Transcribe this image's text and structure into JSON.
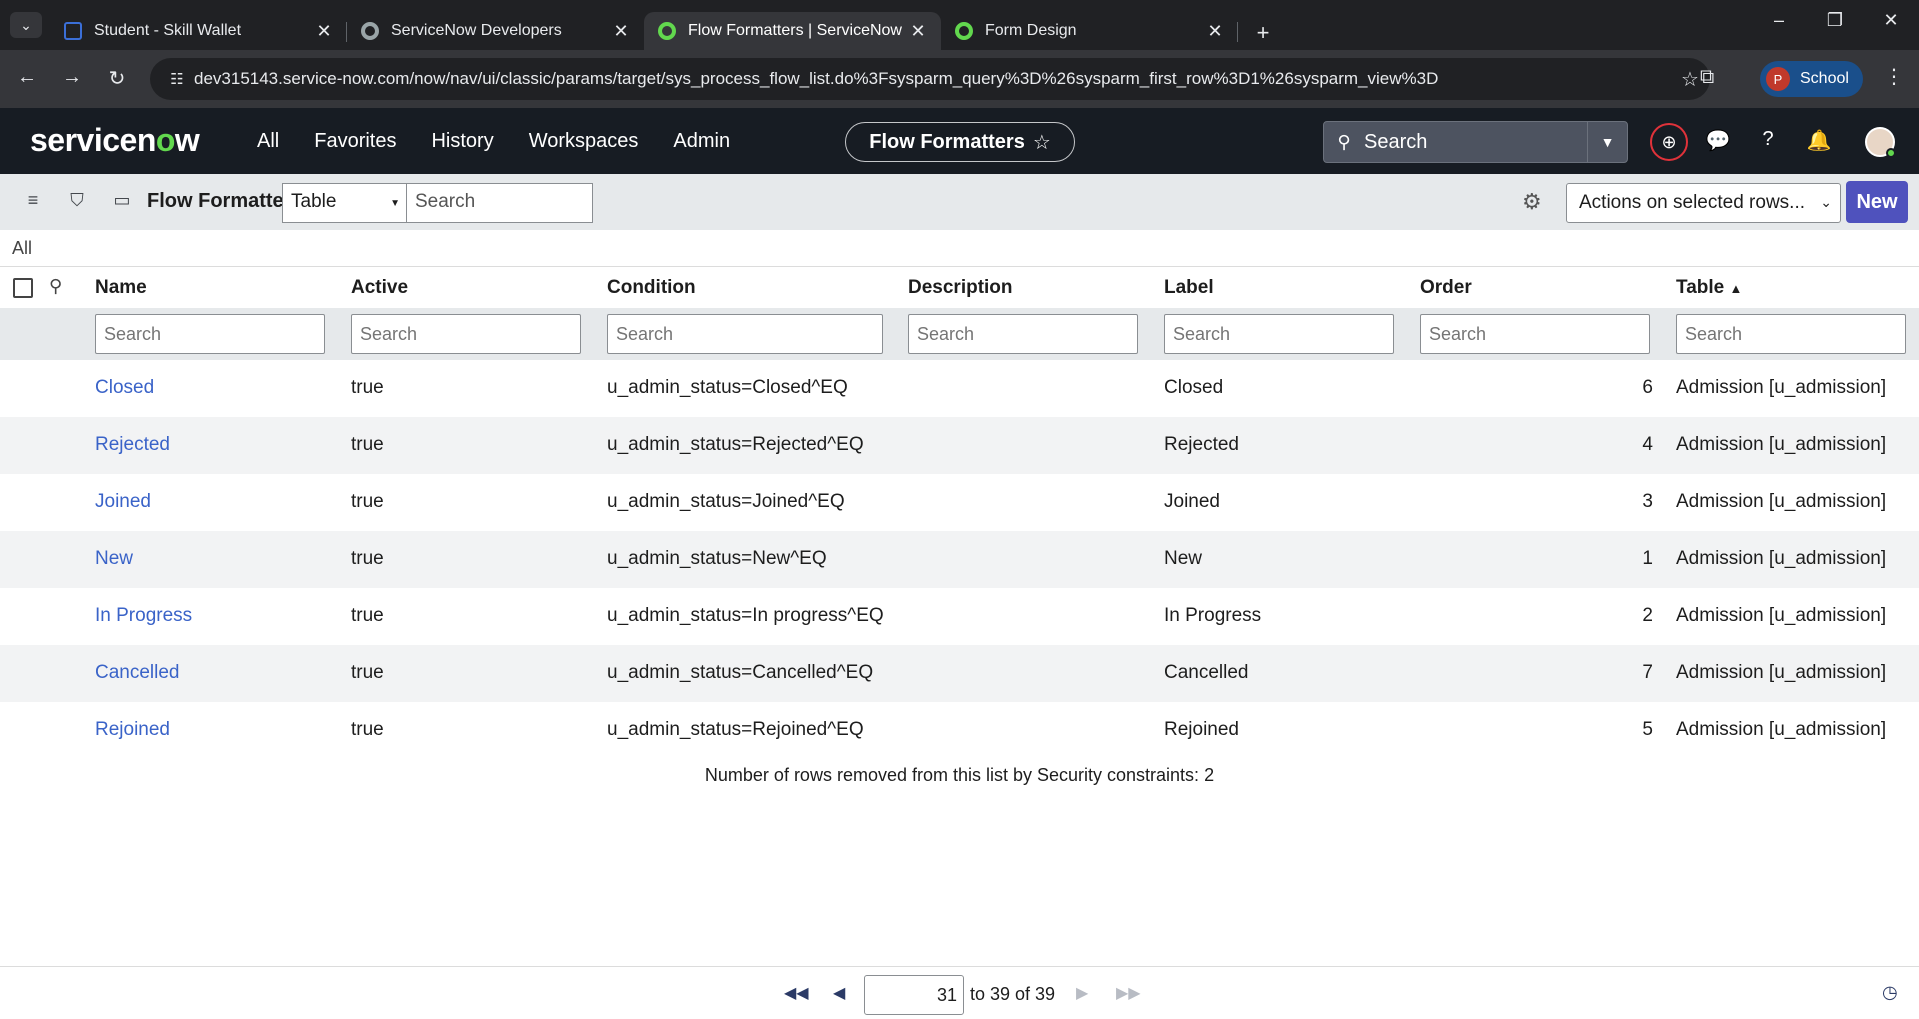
{
  "browser": {
    "tabs": [
      {
        "title": "Student - Skill Wallet",
        "color": "#3b6fd8"
      },
      {
        "title": "ServiceNow Developers",
        "color": "#9aa5a8"
      },
      {
        "title": "Flow Formatters | ServiceNow",
        "color": "#62d84e"
      },
      {
        "title": "Form Design",
        "color": "#62d84e"
      }
    ],
    "url": "dev315143.service-now.com/now/nav/ui/classic/params/target/sys_process_flow_list.do%3Fsysparm_query%3D%26sysparm_first_row%3D1%26sysparm_view%3D",
    "profile_label": "School",
    "profile_initial": "P"
  },
  "header": {
    "logo_pre": "servicen",
    "logo_o": "o",
    "logo_post": "w",
    "nav": [
      "All",
      "Favorites",
      "History",
      "Workspaces",
      "Admin"
    ],
    "context_title": "Flow Formatters",
    "search_placeholder": "Search"
  },
  "listbar": {
    "title": "Flow Formatters",
    "field_select": "Table",
    "search_placeholder": "Search",
    "actions_select": "Actions on selected rows...",
    "new_label": "New"
  },
  "breadcrumb": "All",
  "table": {
    "columns": [
      "Name",
      "Active",
      "Condition",
      "Description",
      "Label",
      "Order",
      "Table"
    ],
    "sort_indicator": "▲",
    "filter_placeholder": "Search",
    "rows": [
      {
        "name": "Closed",
        "active": "true",
        "condition": "u_admin_status=Closed^EQ",
        "description": "",
        "label": "Closed",
        "order": "6",
        "table": "Admission [u_admission]"
      },
      {
        "name": "Rejected",
        "active": "true",
        "condition": "u_admin_status=Rejected^EQ",
        "description": "",
        "label": "Rejected",
        "order": "4",
        "table": "Admission [u_admission]"
      },
      {
        "name": "Joined",
        "active": "true",
        "condition": "u_admin_status=Joined^EQ",
        "description": "",
        "label": "Joined",
        "order": "3",
        "table": "Admission [u_admission]"
      },
      {
        "name": "New",
        "active": "true",
        "condition": "u_admin_status=New^EQ",
        "description": "",
        "label": "New",
        "order": "1",
        "table": "Admission [u_admission]"
      },
      {
        "name": "In Progress",
        "active": "true",
        "condition": "u_admin_status=In progress^EQ",
        "description": "",
        "label": "In Progress",
        "order": "2",
        "table": "Admission [u_admission]"
      },
      {
        "name": "Cancelled",
        "active": "true",
        "condition": "u_admin_status=Cancelled^EQ",
        "description": "",
        "label": "Cancelled",
        "order": "7",
        "table": "Admission [u_admission]"
      },
      {
        "name": "Rejoined",
        "active": "true",
        "condition": "u_admin_status=Rejoined^EQ",
        "description": "",
        "label": "Rejoined",
        "order": "5",
        "table": "Admission [u_admission]"
      }
    ],
    "security_note": "Number of rows removed from this list by Security constraints: 2"
  },
  "pagination": {
    "current": "31",
    "range_text": "to 39 of 39"
  },
  "colors": {
    "accent": "#4f52bd",
    "link": "#3a63c8",
    "header_bg": "#171c23",
    "brand_green": "#62d84e"
  }
}
